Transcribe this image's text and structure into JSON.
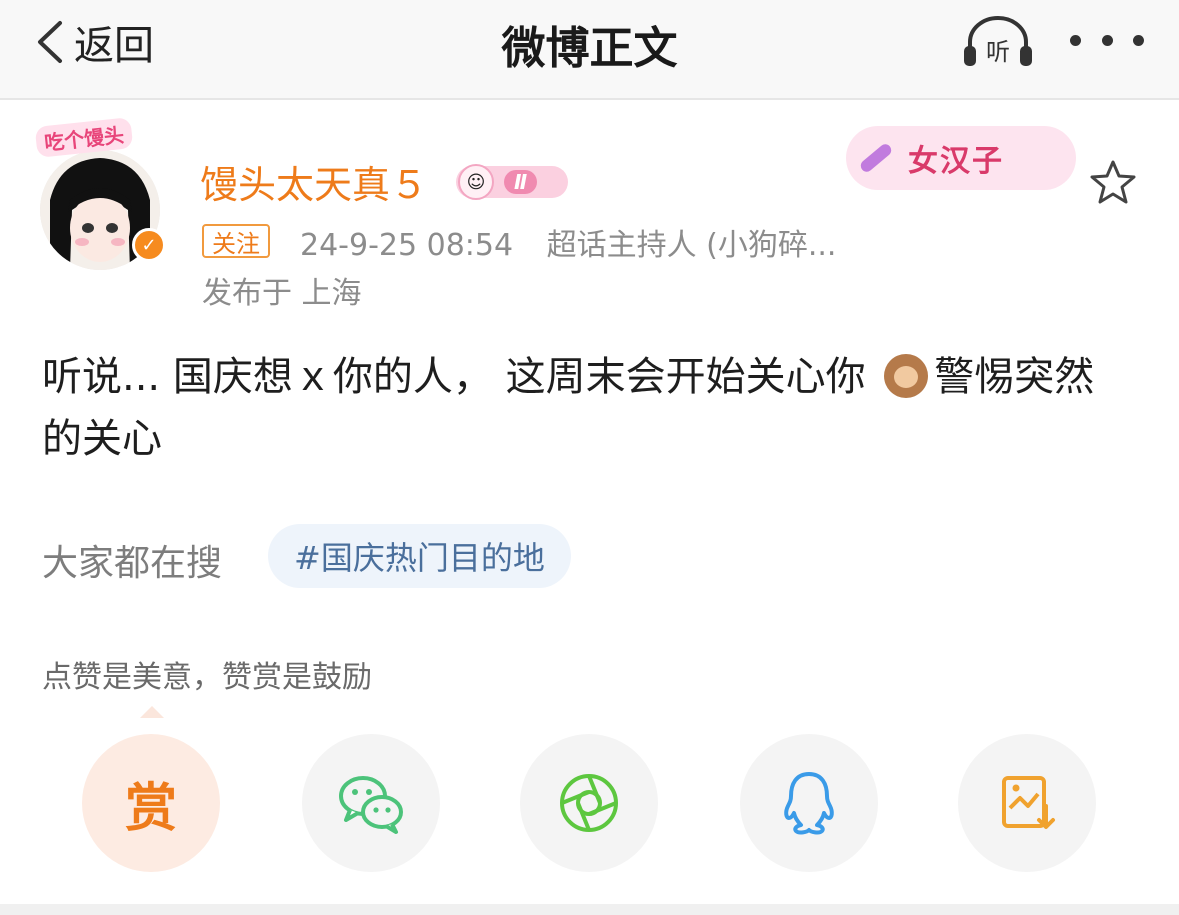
{
  "header": {
    "back_label": "返回",
    "title": "微博正文",
    "listen_label": "听"
  },
  "user": {
    "avatar_tag": "吃个馒头",
    "name": "馒头太天真５",
    "level": "Ⅱ",
    "medal_text": "女汉子",
    "follow_label": "关注",
    "time": "24-9-25 08:54",
    "role": "超话主持人 (小狗碎...",
    "location": "发布于 上海"
  },
  "post": {
    "text_before": "听说... 国庆想ｘ你的人，  这周末会开始关心你 ",
    "emoji": "see-no-evil-monkey",
    "text_after": "警惕突然的关心"
  },
  "search": {
    "label": "大家都在搜",
    "hashtag": "#国庆热门目的地"
  },
  "reward": {
    "label": "点赞是美意，赞赏是鼓励",
    "button": "赏"
  },
  "share": [
    {
      "name": "reward",
      "icon": "reward-icon"
    },
    {
      "name": "wechat",
      "icon": "wechat-icon"
    },
    {
      "name": "moments",
      "icon": "moments-icon"
    },
    {
      "name": "qq",
      "icon": "qq-icon"
    },
    {
      "name": "save-image",
      "icon": "save-image-icon"
    }
  ],
  "colors": {
    "accent": "#ee7b1a",
    "hashtag": "#4a6f9c",
    "wechat": "#4cc37a",
    "moments": "#5dc73f",
    "qq": "#3a9be8"
  }
}
